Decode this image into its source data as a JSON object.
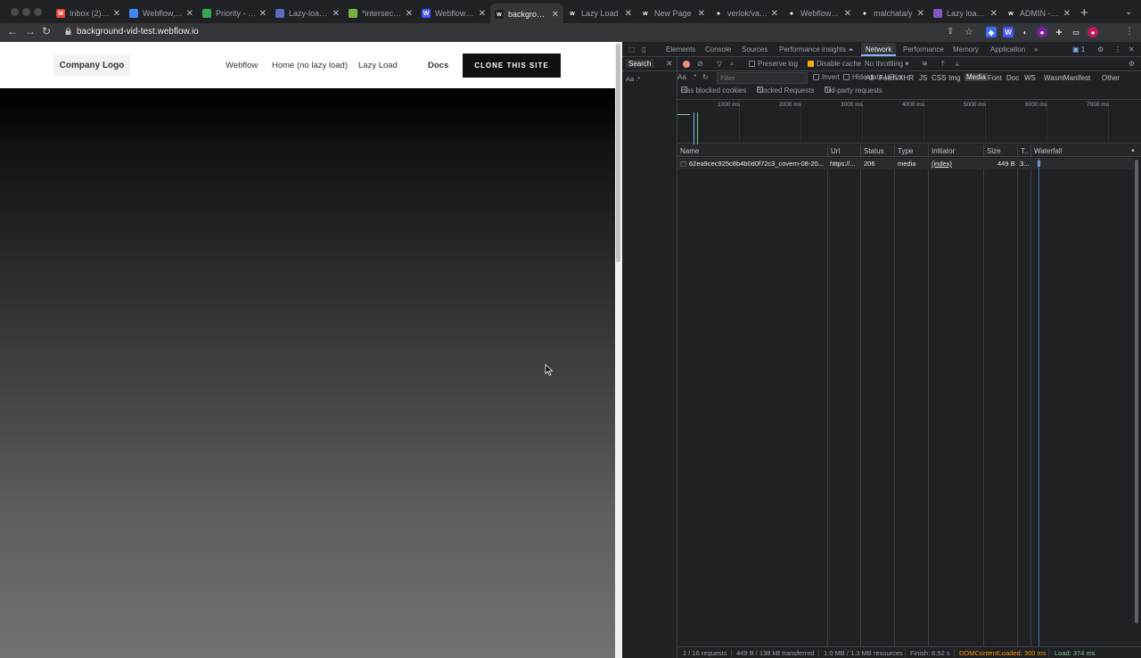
{
  "browser": {
    "tabs": [
      {
        "title": "Inbox (2) - b",
        "icon": "gmail-icon",
        "color": "#ea4335",
        "glyph": "M"
      },
      {
        "title": "Webflow, In",
        "icon": "webflow-doc-icon",
        "color": "#4285f4",
        "glyph": ""
      },
      {
        "title": "Priority - Go",
        "icon": "drive-icon",
        "color": "#34a853",
        "glyph": ""
      },
      {
        "title": "Lazy-loading",
        "icon": "lazy-icon",
        "color": "#5c6bc0",
        "glyph": ""
      },
      {
        "title": "*intersection",
        "icon": "sheet-icon",
        "color": "#7cb342",
        "glyph": ""
      },
      {
        "title": "Webflow - b",
        "icon": "webflow-icon",
        "color": "#4353ff",
        "glyph": "W"
      },
      {
        "title": "background",
        "icon": "webflow-w-icon",
        "color": "#202124",
        "glyph": "w",
        "active": true
      },
      {
        "title": "Lazy Load",
        "icon": "webflow-w-icon",
        "color": "#202124",
        "glyph": "w"
      },
      {
        "title": "New Page",
        "icon": "webflow-w-icon",
        "color": "#202124",
        "glyph": "w"
      },
      {
        "title": "verlok/vanill",
        "icon": "github-icon",
        "color": "#202124",
        "glyph": "●"
      },
      {
        "title": "Webflow Ex",
        "icon": "github-icon",
        "color": "#202124",
        "glyph": "●"
      },
      {
        "title": "malchata/y",
        "icon": "github-icon",
        "color": "#202124",
        "glyph": "●"
      },
      {
        "title": "Lazy loading",
        "icon": "lazy-icon",
        "color": "#7e57c2",
        "glyph": ""
      },
      {
        "title": "ADMIN - We",
        "icon": "webflow-w-icon",
        "color": "#202124",
        "glyph": "w"
      }
    ],
    "url": "background-vid-test.webflow.io"
  },
  "site": {
    "logo": "Company Logo",
    "nav": [
      "Webflow",
      "Home (no lazy load)",
      "Lazy Load",
      "Docs"
    ],
    "cta": "CLONE THIS SITE"
  },
  "devtools": {
    "tabs": [
      "Elements",
      "Console",
      "Sources",
      "Performance insights ⏶",
      "Network",
      "Performance",
      "Memory",
      "Application",
      "»"
    ],
    "active_tab": "Network",
    "issues_badge": "1",
    "search": {
      "title": "Search",
      "options": "Aa  .*"
    },
    "toolbar": {
      "preserve_log": "Preserve log",
      "disable_cache": "Disable cache",
      "throttling": "No throttling"
    },
    "filter": {
      "placeholder": "Filter",
      "invert": "Invert",
      "hide_data_urls": "Hide data URLs",
      "types": [
        "All",
        "Fetch/XHR",
        "JS",
        "CSS",
        "Img",
        "Media",
        "Font",
        "Doc",
        "WS",
        "Wasm",
        "Manifest",
        "Other"
      ],
      "active_type": "Media",
      "has_blocked_cookies": "Has blocked cookies",
      "blocked_requests": "Blocked Requests",
      "third_party": "3rd-party requests"
    },
    "timeline_ticks": [
      "1000 ms",
      "2000 ms",
      "3000 ms",
      "4000 ms",
      "5000 ms",
      "6000 ms",
      "7000 ms"
    ],
    "columns": {
      "name": "Name",
      "url": "Url",
      "status": "Status",
      "type": "Type",
      "initiator": "Initiator",
      "size": "Size",
      "time": "T..",
      "waterfall": "Waterfall"
    },
    "rows": [
      {
        "name": "62ea9cec925c8b4b0d0f72c3_covern-08-20...",
        "url": "https://...",
        "status": "206",
        "type": "media",
        "initiator": "(index)",
        "size": "449 B",
        "time": "3..."
      }
    ],
    "status": {
      "requests": "1 / 16 requests",
      "transferred": "449 B / 138 kB transferred",
      "resources": "1.0 MB / 1.3 MB resources",
      "finish": "Finish: 6.52 s",
      "dom_loaded": "DOMContentLoaded: 300 ms",
      "load": "Load: 374 ms"
    },
    "colors": {
      "dom_loaded": "#f29900",
      "load": "#81c995",
      "accent": "#8ab4f8"
    }
  }
}
